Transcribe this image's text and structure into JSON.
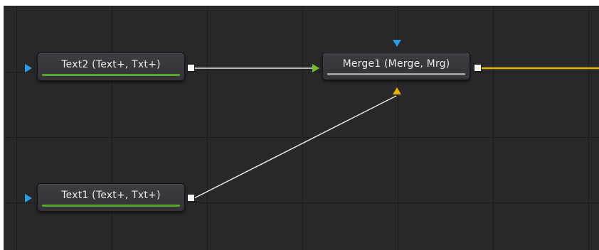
{
  "nodes": {
    "text2": {
      "label": "Text2  (Text+, Txt+)"
    },
    "text1": {
      "label": "Text1  (Text+, Txt+)"
    },
    "merge1": {
      "label": "Merge1  (Merge, Mrg)"
    }
  },
  "colors": {
    "canvas_bg": "#28282b",
    "grid_line": "#1d1d20",
    "wire_white": "#e6e6e6",
    "wire_output": "#e8b400",
    "port_input_blue": "#2a9be0",
    "port_foreground_green": "#6fbf2c",
    "port_background_yellow": "#e8b400",
    "bar_green": "#56a62a",
    "bar_gray": "#9c9c9c"
  },
  "icons": {
    "text2_input": "triangle-right-blue",
    "text1_input": "triangle-right-blue",
    "merge1_background_input": "triangle-up-yellow",
    "merge1_foreground_input": "triangle-right-green",
    "merge1_effect_mask_input": "triangle-down-blue",
    "output_port": "white-square"
  }
}
